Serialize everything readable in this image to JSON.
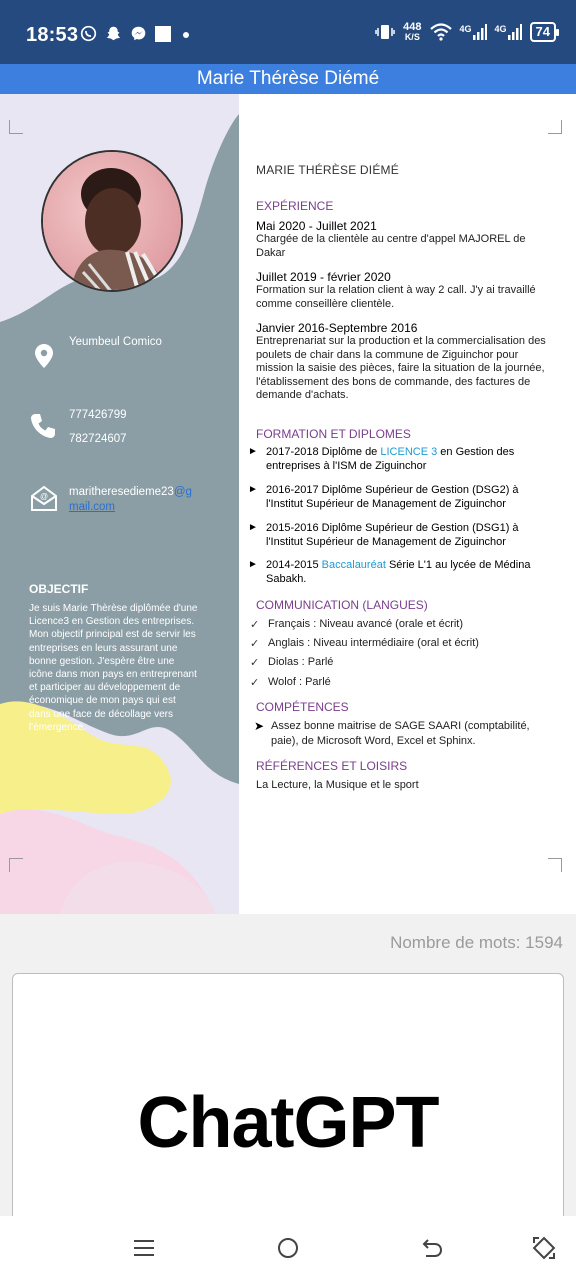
{
  "status_bar": {
    "time": "18:53",
    "net_speed_value": "448",
    "net_speed_unit": "K/S",
    "signal1": "4G",
    "signal2": "4G",
    "battery": "74",
    "icons": [
      "whatsapp-icon",
      "snapchat-icon",
      "messenger-icon",
      "square-icon",
      "dot-icon",
      "vibrate-icon",
      "wifi-icon",
      "signal-icon"
    ]
  },
  "document": {
    "title": "Marie Thérèse Diémé",
    "sidebar": {
      "address": "Yeumbeul Comico",
      "phone1": "777426799",
      "phone2": "782724607",
      "email_prefix": "maritheresedieme23",
      "email_at": "@g",
      "email_domain": "mail.com",
      "objectif_title": "OBJECTIF",
      "objectif_text": "Je suis Marie Thèrèse diplômée d'une   Licence3 en Gestion des entreprises. Mon objectif principal est de servir les entreprises en leurs assurant une bonne gestion. J'espère être une icône dans mon pays en entreprenant et participer au développement de économique de mon pays qui est dans une face de décollage vers l'émergence."
    },
    "main": {
      "name": "MARIE THÉRÈSE DIÉMÉ",
      "experience_title": "EXPÉRIENCE",
      "experiences": [
        {
          "date": "Mai 2020 - Juillet 2021",
          "desc": "Chargée de la clientèle au centre d'appel MAJOREL de Dakar"
        },
        {
          "date": "Juillet 2019 - février 2020",
          "desc": "Formation sur la relation client à way 2 call. J'y ai travaillé comme conseillère clientèle."
        },
        {
          "date": "Janvier 2016-Septembre 2016",
          "desc": "Entreprenariat sur la production et la commercialisation des poulets de chair dans la commune de Ziguinchor pour mission la saisie des pièces, faire la situation de la journée, l'établissement des bons de commande, des factures de demande d'achats."
        }
      ],
      "formation_title": "FORMATION ET DIPLOMES",
      "formations": [
        {
          "pre": "2017-2018 Diplôme de ",
          "hl": "LICENCE 3",
          "post": " en Gestion des entreprises à l'ISM de Ziguinchor"
        },
        {
          "pre": "2016-2017 Diplôme Supérieur de Gestion (DSG2) à l'Institut Supérieur de Management de Ziguinchor",
          "hl": "",
          "post": ""
        },
        {
          "pre": "2015-2016 Diplôme Supérieur de Gestion (DSG1) à l'Institut Supérieur de Management de Ziguinchor",
          "hl": "",
          "post": ""
        },
        {
          "pre": "2014-2015 ",
          "hl": "Baccalauréat",
          "post": " Série L'1 au lycée de Médina Sabakh."
        }
      ],
      "communication_title": "COMMUNICATION (LANGUES)",
      "languages": [
        "Français : Niveau avancé (orale et écrit)",
        "Anglais : Niveau intermédiaire (oral et écrit)",
        "Diolas : Parlé",
        "Wolof : Parlé"
      ],
      "competences_title": "COMPÉTENCES",
      "competence": "Assez bonne maitrise de SAGE SAARI (comptabilité, paie), de Microsoft Word, Excel et Sphinx.",
      "references_title": "RÉFÉRENCES ET LOISIRS",
      "references": "La Lecture, la Musique et le sport"
    }
  },
  "word_count": "Nombre de mots: 1594",
  "card": {
    "logo_text": "ChatGPT"
  },
  "nav": {
    "icons": [
      "menu-icon",
      "home-icon",
      "back-icon",
      "rotate-icon"
    ]
  },
  "colors": {
    "status_bar": "#254a80",
    "title_bar": "#3d7fde",
    "sidebar": "#8b9ea5",
    "section_title": "#7a3e8c",
    "highlight": "#1b9bd6"
  }
}
